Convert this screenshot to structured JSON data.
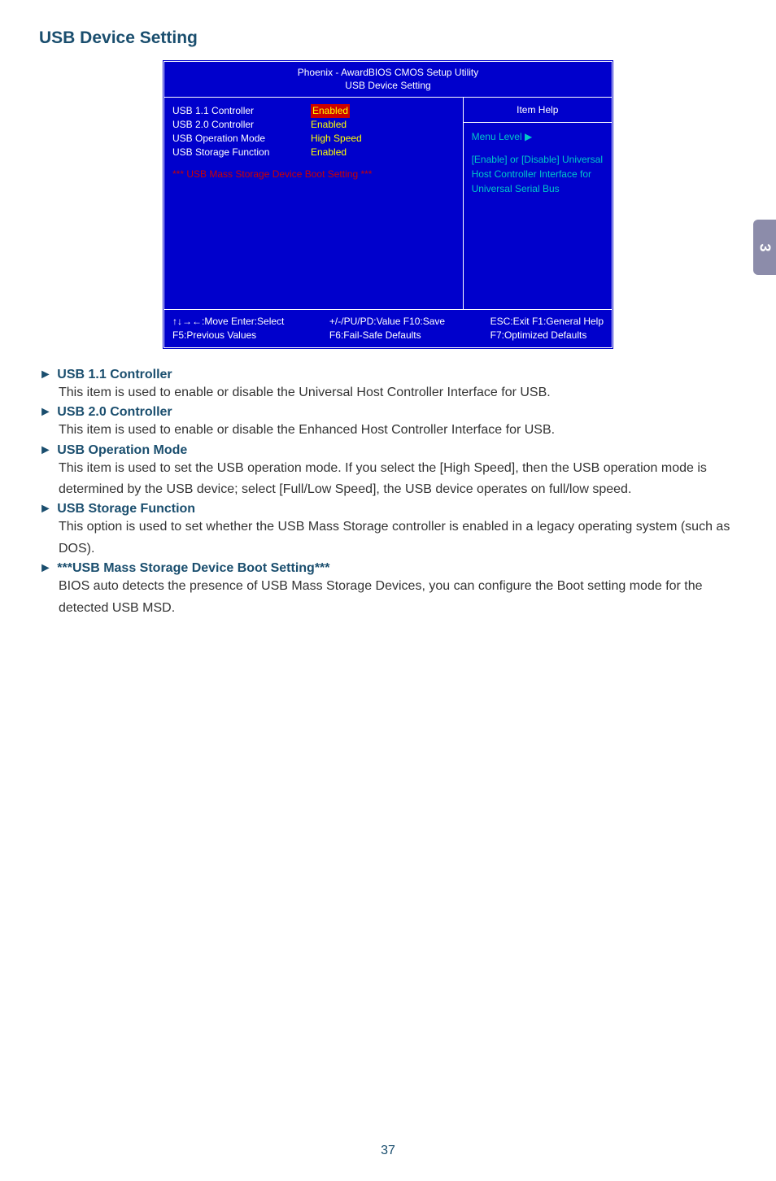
{
  "pageTitle": "USB Device Setting",
  "sideTab": "3",
  "pageNumber": "37",
  "bios": {
    "headerLine1": "Phoenix - AwardBIOS CMOS Setup Utility",
    "headerLine2": "USB Device Setting",
    "settings": [
      {
        "label": "USB 1.1 Controller",
        "value": "Enabled",
        "selected": true
      },
      {
        "label": "USB 2.0 Controller",
        "value": "Enabled",
        "selected": false
      },
      {
        "label": "USB Operation Mode",
        "value": "High Speed",
        "selected": false
      },
      {
        "label": "USB Storage Function",
        "value": "Enabled",
        "selected": false
      }
    ],
    "bootSetting": "*** USB Mass Storage Device Boot Setting ***",
    "help": {
      "title": "Item Help",
      "menuLevel": "Menu Level  ▶",
      "body": "[Enable] or [Disable] Universal Host Controller Interface for Universal Serial Bus"
    },
    "footer": {
      "c1a": "↑↓→←:Move   Enter:Select",
      "c1b": "F5:Previous Values",
      "c2a": "+/-/PU/PD:Value   F10:Save",
      "c2b": "F6:Fail-Safe Defaults",
      "c3a": "ESC:Exit   F1:General Help",
      "c3b": "F7:Optimized Defaults"
    }
  },
  "items": [
    {
      "title": "USB 1.1 Controller",
      "body": "This item is used to enable or disable the Universal Host Controller Interface for USB."
    },
    {
      "title": "USB 2.0 Controller",
      "body": "This item is used to enable or disable the Enhanced Host Controller Interface for USB."
    },
    {
      "title": "USB Operation Mode",
      "body": "This item is used to set the USB operation mode. If you select the [High Speed], then the USB operation mode is determined by the USB device; select [Full/Low Speed], the USB device operates on full/low speed."
    },
    {
      "title": "USB Storage Function",
      "body": "This option is used to set whether the USB Mass Storage controller is enabled in a legacy operating system (such as DOS)."
    },
    {
      "title": "***USB Mass Storage Device Boot Setting***",
      "body": "BIOS auto detects the presence of USB Mass Storage Devices, you can configure the Boot setting mode for the detected USB MSD."
    }
  ]
}
